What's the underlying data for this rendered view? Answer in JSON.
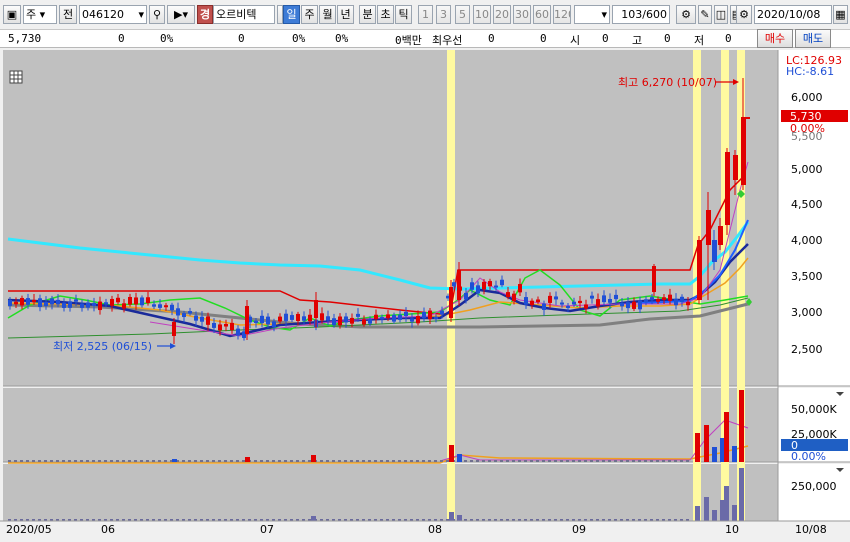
{
  "toolbar": {
    "type_label": "주",
    "jeon_label": "전",
    "code": "046120",
    "badge": "경",
    "name": "오르비텍",
    "period_tabs": [
      "일",
      "주",
      "월",
      "년",
      "분",
      "초",
      "틱"
    ],
    "active_period": "일",
    "intervals": [
      "1",
      "3",
      "5",
      "10",
      "20",
      "30",
      "60",
      "120"
    ],
    "count": "103",
    "count_total": "/600",
    "date": "2020/10/08"
  },
  "info": {
    "price": "5,730",
    "v1": "0",
    "p1": "0%",
    "v2": "0",
    "p2": "0%",
    "p3": "0%",
    "unit": "0백만",
    "best_label": "최우선",
    "best1": "0",
    "best2": "0",
    "open_label": "시",
    "open": "0",
    "high_label": "고",
    "high": "0",
    "low_label": "저",
    "low": "0",
    "buy_label": "매수",
    "sell_label": "매도"
  },
  "chart": {
    "lc_label": "LC:126.93",
    "hc_label": "HC:-8.61",
    "price_ticks": [
      "6,000",
      "5,500",
      "5,000",
      "4,500",
      "4,000",
      "3,500",
      "3,000",
      "2,500"
    ],
    "current_price": "5,730",
    "current_pct": "0.00%",
    "high_annotation": "최고 6,270 (10/07)",
    "low_annotation": "최저 2,525 (06/15)",
    "volume_ticks": [
      "50,000K",
      "25,000K"
    ],
    "volume_current": "0",
    "volume_pct": "0.00%",
    "lower_tick": "250,000",
    "dates": [
      "2020/05",
      "06",
      "07",
      "08",
      "09",
      "10"
    ],
    "right_date": "10/08",
    "colors": {
      "up": "#e00000",
      "down": "#1f4fd6",
      "bg": "#c0c0c0",
      "highlight": "#fffaa0"
    }
  },
  "chart_data": {
    "type": "candlestick",
    "period": "daily",
    "high": {
      "value": 6270,
      "date": "10/07"
    },
    "low": {
      "value": 2525,
      "date": "06/15"
    },
    "last": 5730,
    "ylim": [
      2300,
      6500
    ]
  }
}
